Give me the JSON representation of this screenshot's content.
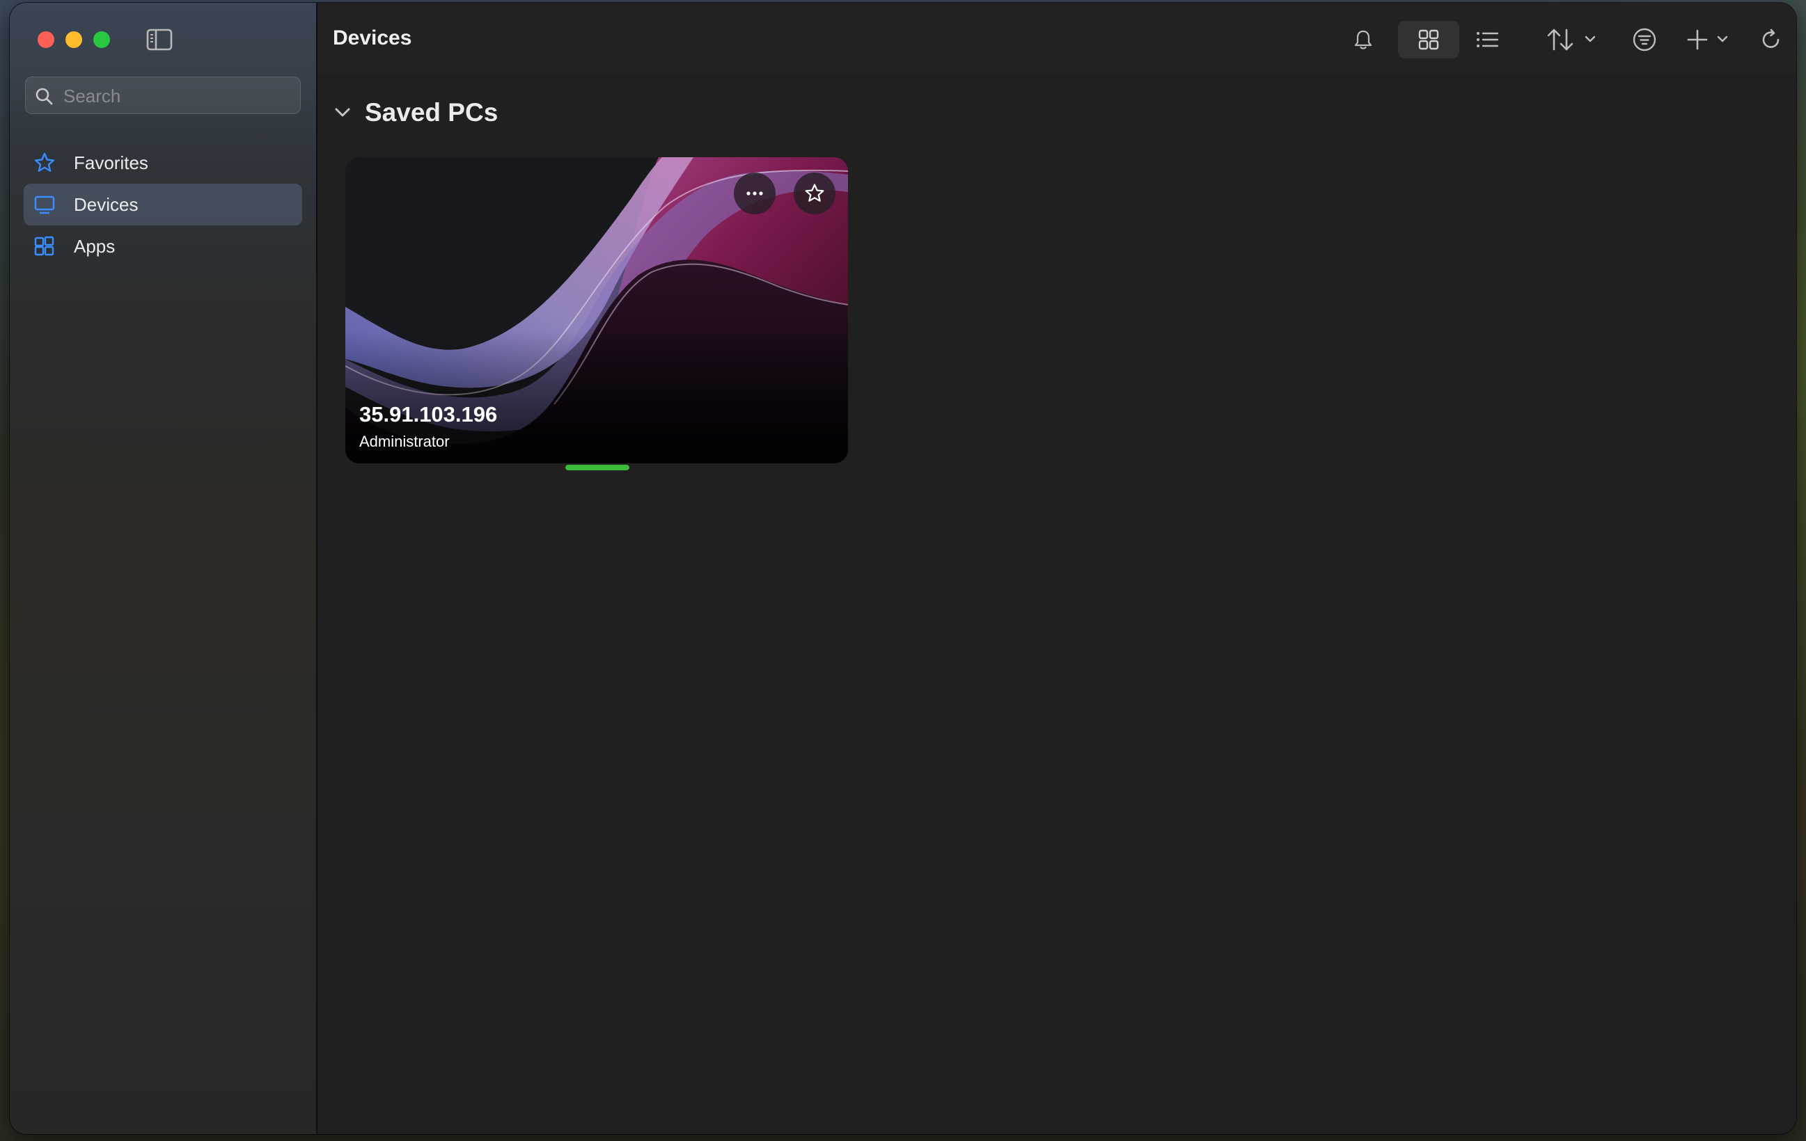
{
  "window": {
    "traffic_lights": [
      "close",
      "minimize",
      "zoom"
    ]
  },
  "sidebar": {
    "toggle_icon": "sidebar-icon",
    "search": {
      "placeholder": "Search",
      "value": ""
    },
    "items": [
      {
        "label": "Favorites",
        "icon": "star-icon",
        "selected": false
      },
      {
        "label": "Devices",
        "icon": "monitor-icon",
        "selected": true
      },
      {
        "label": "Apps",
        "icon": "apps-grid-icon",
        "selected": false
      }
    ]
  },
  "header": {
    "title": "Devices",
    "tools": [
      "bell-icon",
      "grid-view-icon",
      "list-view-icon",
      "sort-icon",
      "filter-icon",
      "add-icon",
      "refresh-icon"
    ],
    "active_view": "grid"
  },
  "section": {
    "title": "Saved PCs",
    "expanded": true
  },
  "devices": [
    {
      "name": "35.91.103.196",
      "user": "Administrator",
      "status_color": "#3dbb3a",
      "status_level": 1.0
    }
  ],
  "colors": {
    "accent": "#3a8dff",
    "status_green": "#3dbb3a"
  }
}
